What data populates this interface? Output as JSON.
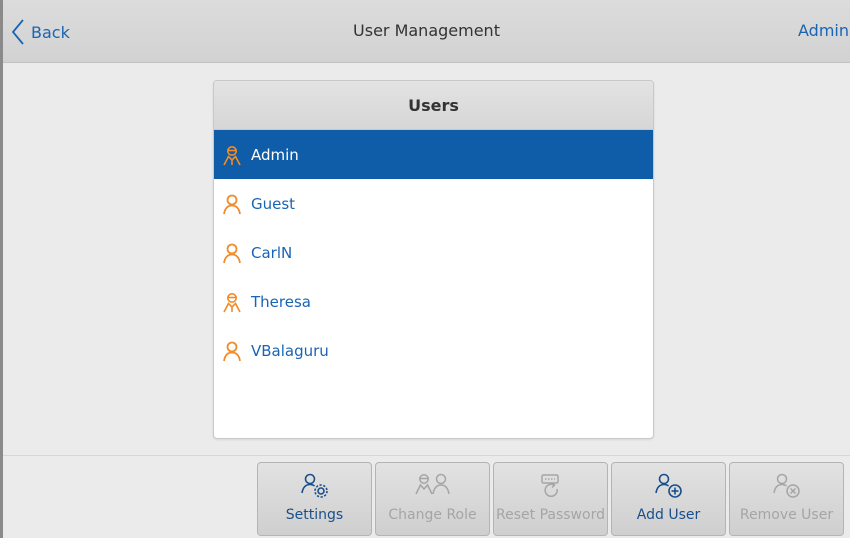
{
  "header": {
    "back_label": "Back",
    "title": "User Management",
    "current_user": "Admin"
  },
  "users_panel": {
    "title": "Users",
    "users": [
      {
        "name": "Admin",
        "role_icon": "admin-user-icon",
        "selected": true
      },
      {
        "name": "Guest",
        "role_icon": "user-icon",
        "selected": false
      },
      {
        "name": "CarlN",
        "role_icon": "user-icon",
        "selected": false
      },
      {
        "name": "Theresa",
        "role_icon": "admin-user-icon",
        "selected": false
      },
      {
        "name": "VBalaguru",
        "role_icon": "user-icon",
        "selected": false
      }
    ]
  },
  "toolbar": {
    "settings_label": "Settings",
    "change_role_label": "Change Role",
    "reset_password_label": "Reset Password",
    "add_user_label": "Add User",
    "remove_user_label": "Remove User"
  },
  "colors": {
    "accent": "#1a64b4",
    "selected_row": "#0f5ca8",
    "user_icon": "#f28c28",
    "disabled": "#a5a5a5"
  }
}
